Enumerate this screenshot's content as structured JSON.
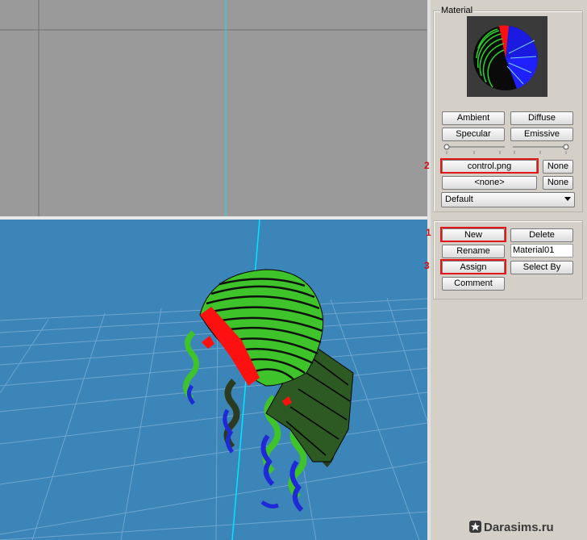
{
  "material_panel": {
    "group_label": "Material",
    "buttons": {
      "ambient": "Ambient",
      "diffuse": "Diffuse",
      "specular": "Specular",
      "emissive": "Emissive"
    },
    "texture_slot": "control.png",
    "texture_none": "None",
    "second_slot": "<none>",
    "second_none": "None",
    "blend_mode": "Default"
  },
  "actions_panel": {
    "new": "New",
    "delete": "Delete",
    "rename": "Rename",
    "material_name": "Material01",
    "assign": "Assign",
    "select_by": "Select By",
    "comment": "Comment"
  },
  "annotations": {
    "step1": "1",
    "step2": "2",
    "step3": "3"
  },
  "watermark": {
    "text": "Darasims.ru",
    "icon": "star-badge-icon"
  },
  "colors": {
    "viewport_top_bg": "#9a9a9a",
    "viewport_bottom_bg": "#3b85b9",
    "highlight_red": "#e01818",
    "axis_cyan": "#00e5ff",
    "hair_green": "#3fc32a",
    "hair_blue": "#1e2ad8",
    "hair_red": "#ff1010"
  }
}
